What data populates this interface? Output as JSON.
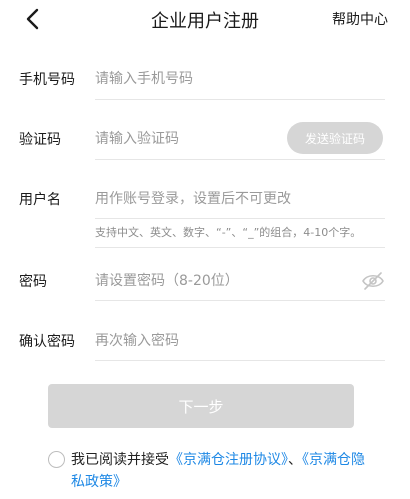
{
  "header": {
    "title": "企业用户注册",
    "help_label": "帮助中心"
  },
  "form": {
    "phone": {
      "label": "手机号码",
      "placeholder": "请输入手机号码"
    },
    "code": {
      "label": "验证码",
      "placeholder": "请输入验证码",
      "send_label": "发送验证码"
    },
    "username": {
      "label": "用户名",
      "placeholder": "用作账号登录，设置后不可更改",
      "hint": "支持中文、英文、数字、“-”、“_”的组合，4-10个字。"
    },
    "password": {
      "label": "密码",
      "placeholder": "请设置密码（8-20位）",
      "toggle_icon": "eye-slash-icon"
    },
    "confirm": {
      "label": "确认密码",
      "placeholder": "再次输入密码"
    }
  },
  "next_label": "下一步",
  "agreement": {
    "prefix": "我已阅读并接受",
    "link1": "《京满仓注册协议》",
    "separator": "、",
    "link2": "《京满仓隐私政策》",
    "checked": false
  },
  "colors": {
    "link": "#1e88e5",
    "disabled_button": "#d6d6d6",
    "divider": "#e6e6e6"
  }
}
